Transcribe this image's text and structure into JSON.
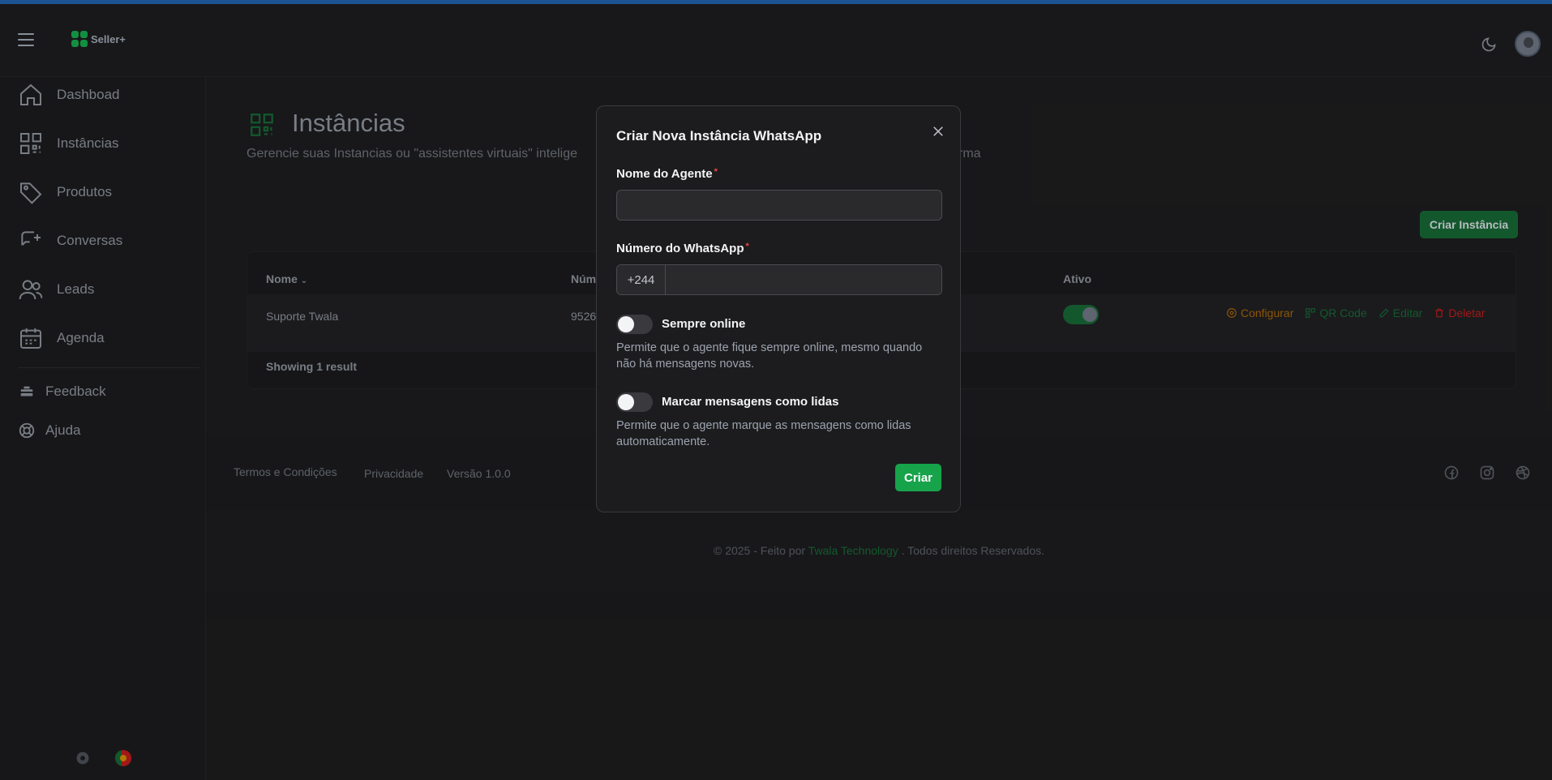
{
  "header": {
    "logo_text": "Seller+"
  },
  "sidebar": {
    "items": [
      {
        "label": "Dashboad",
        "icon": "home-icon"
      },
      {
        "label": "Instâncias",
        "icon": "qr-code-icon"
      },
      {
        "label": "Produtos",
        "icon": "tag-icon"
      },
      {
        "label": "Conversas",
        "icon": "chat-icon"
      },
      {
        "label": "Leads",
        "icon": "users-icon"
      },
      {
        "label": "Agenda",
        "icon": "calendar-icon"
      }
    ],
    "secondary": [
      {
        "label": "Feedback",
        "icon": "feedback-icon"
      },
      {
        "label": "Ajuda",
        "icon": "help-icon"
      }
    ]
  },
  "page": {
    "title": "Instâncias",
    "subtitle": "Gerencie suas Instancias ou \"assistentes virtuais\" intelige",
    "subtitle_end": "rma",
    "create_button": "Criar Instância"
  },
  "table": {
    "headers": {
      "name": "Nome",
      "number": "Núm",
      "active": "Ativo"
    },
    "rows": [
      {
        "name": "Suporte Twala",
        "number": "9526",
        "active": true
      }
    ],
    "actions": {
      "configure": "Configurar",
      "qr": "QR Code",
      "edit": "Editar",
      "delete": "Deletar"
    },
    "footer": "Showing 1 result"
  },
  "footer": {
    "links": [
      "Termos e Condições",
      "Privacidade",
      "Versão 1.0.0"
    ],
    "copyright_prefix": "© 2025 - Feito por ",
    "copyright_brand": "Twala Technology",
    "copyright_suffix": " . Todos direitos Reservados."
  },
  "modal": {
    "title": "Criar Nova Instância WhatsApp",
    "agent_name_label": "Nome do Agente",
    "agent_name_value": "",
    "whatsapp_label": "Número do WhatsApp",
    "country_code": "+244",
    "whatsapp_value": "",
    "required_mark": "*",
    "always_online_label": "Sempre online",
    "always_online_help": "Permite que o agente fique sempre online, mesmo quando não há mensagens novas.",
    "mark_read_label": "Marcar mensagens como lidas",
    "mark_read_help": "Permite que o agente marque as mensagens como lidas automaticamente.",
    "submit": "Criar"
  },
  "colors": {
    "accent": "#16a34a",
    "accent_dark": "#166534",
    "required": "#ef4444",
    "configure": "#a16207",
    "delete": "#b91c1c"
  }
}
